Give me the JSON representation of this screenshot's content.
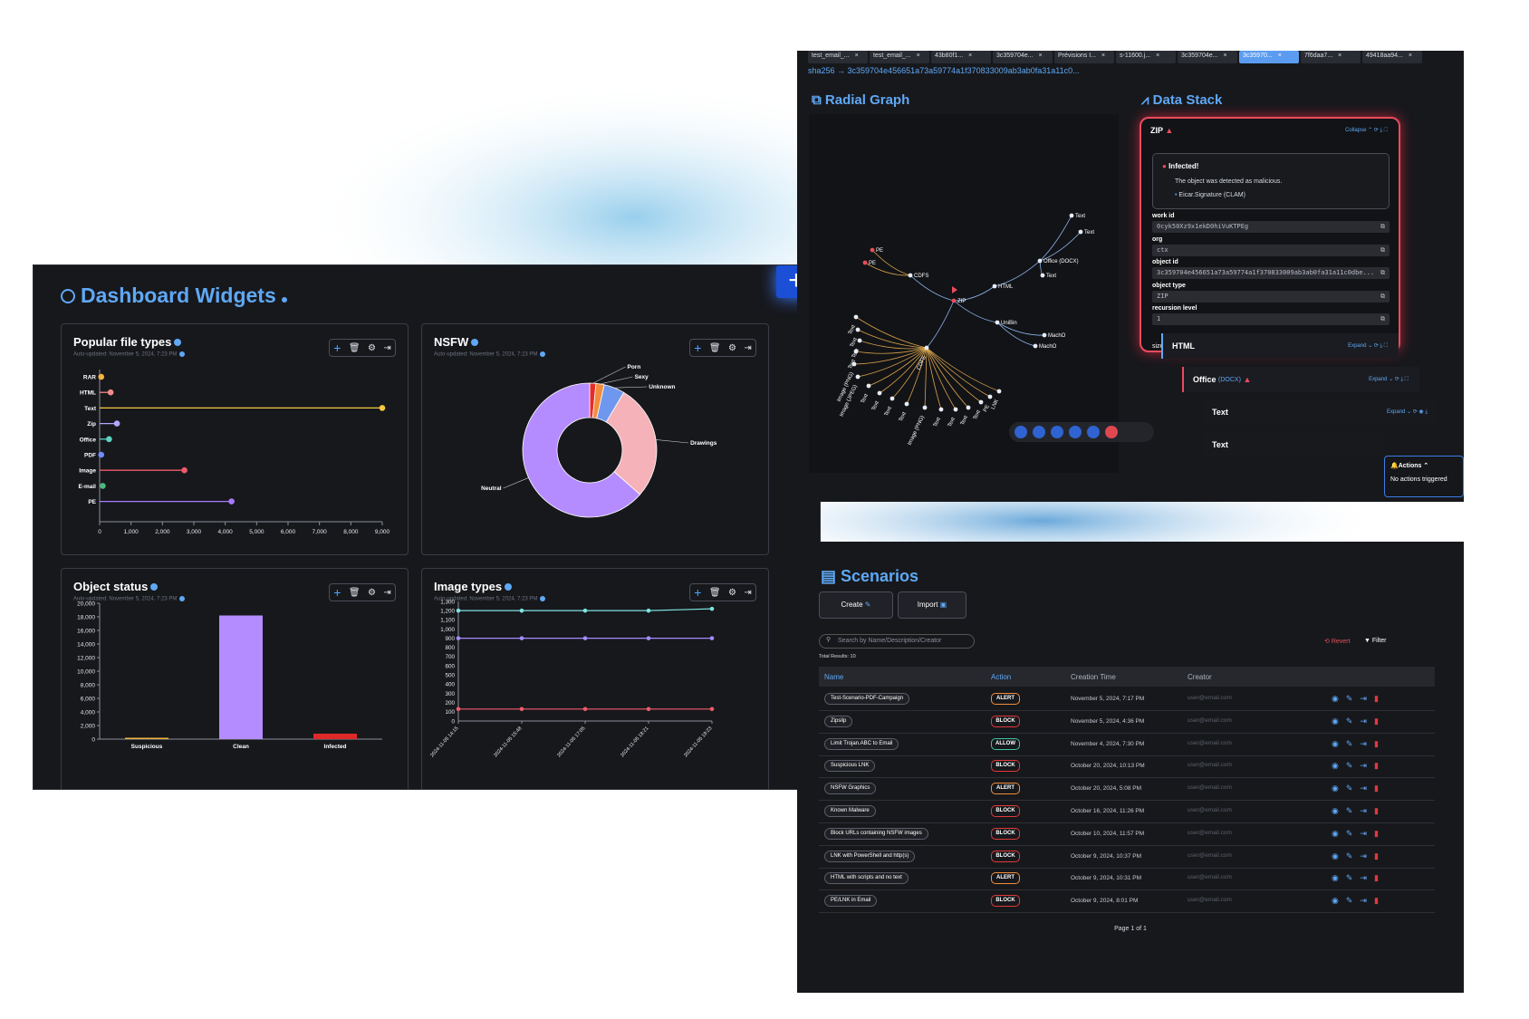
{
  "dashboard": {
    "title": "Dashboard Widgets",
    "add": "+",
    "cards": {
      "popular": {
        "title": "Popular file types",
        "sub": "Auto-updated: November 5, 2024, 7:23 PM"
      },
      "nsfw": {
        "title": "NSFW",
        "sub": "Auto-updated: November 5, 2024, 7:23 PM"
      },
      "status": {
        "title": "Object status",
        "sub": "Auto-updated: November 5, 2024, 7:23 PM"
      },
      "image": {
        "title": "Image types",
        "sub": "Auto-updated: November 5, 2024, 7:23 PM"
      }
    },
    "toolbar_icons": [
      "plus-icon",
      "trash-icon",
      "gear-icon",
      "export-icon"
    ]
  },
  "chart_data": [
    {
      "type": "scatter",
      "title": "Popular file types",
      "categories": [
        "RAR",
        "HTML",
        "Text",
        "Zip",
        "Office",
        "PDF",
        "Image",
        "E-mail",
        "PE"
      ],
      "values": [
        50,
        350,
        9000,
        550,
        300,
        50,
        2700,
        100,
        4200
      ],
      "colors": [
        "#f5b53d",
        "#f28b8b",
        "#f5c842",
        "#b6a6ff",
        "#5fd3c2",
        "#6f8cff",
        "#ef5b6c",
        "#4cb87a",
        "#a77bff"
      ],
      "xticks": [
        "0",
        "1,000",
        "2,000",
        "3,000",
        "4,000",
        "5,000",
        "6,000",
        "7,000",
        "8,000",
        "9,000"
      ],
      "xlim": [
        0,
        9000
      ]
    },
    {
      "type": "pie",
      "title": "NSFW",
      "labels": [
        "Porn",
        "Sexy",
        "Unknown",
        "Drawings",
        "Neutral"
      ],
      "values": [
        1.5,
        2,
        5,
        28,
        63.5
      ],
      "colors": [
        "#e82c2c",
        "#f28d3b",
        "#6f97ee",
        "#f5b2b8",
        "#b48cff"
      ]
    },
    {
      "type": "bar",
      "title": "Object status",
      "categories": [
        "Suspicious",
        "Clean",
        "Infected"
      ],
      "values": [
        150,
        18200,
        800
      ],
      "colors": [
        "#f5b53d",
        "#b48cff",
        "#e02828"
      ],
      "yticks": [
        "0",
        "2,000",
        "4,000",
        "6,000",
        "8,000",
        "10,000",
        "12,000",
        "14,000",
        "16,000",
        "18,000",
        "20,000"
      ],
      "ylim": [
        0,
        20000
      ]
    },
    {
      "type": "line",
      "title": "Image types",
      "x": [
        "2024-11-05 14:15",
        "2024-11-05 15:48",
        "2024-11-05 17:05",
        "2024-11-05 18:21",
        "2024-11-05 19:23"
      ],
      "series": [
        {
          "values": [
            1200,
            1200,
            1200,
            1200,
            1220
          ],
          "color": "#7de3e0"
        },
        {
          "values": [
            900,
            900,
            900,
            900,
            900
          ],
          "color": "#a68bff"
        },
        {
          "values": [
            130,
            130,
            130,
            130,
            130
          ],
          "color": "#ef5b6c"
        }
      ],
      "yticks": [
        "0",
        "100",
        "200",
        "300",
        "400",
        "500",
        "600",
        "700",
        "800",
        "900",
        "1,000",
        "1,100",
        "1,200",
        "1,300"
      ],
      "ylim": [
        0,
        1300
      ]
    }
  ],
  "radial": {
    "tabs": [
      "test_email_...",
      "test_email_...",
      "43b80f1...",
      "3c359704e...",
      "Prévisions I...",
      "s-11600.j...",
      "3c359704e...",
      "3c35970...",
      "7f6daa7...",
      "49418aa94..."
    ],
    "sha": "sha256 → 3c359704e456651a73a59774a1f370833009ab3ab0fa31a11c0...",
    "graph_title": "Radial Graph",
    "stack_title": "Data Stack",
    "nodes": [
      "PE",
      "PE",
      "CDFS",
      "ZIP",
      "HTML",
      "Office (DOCX)",
      "Text",
      "Text",
      "Text",
      "UniBin",
      "MachO",
      "MachO",
      "Text",
      "CDFS",
      "Text",
      "Text",
      "Text",
      "Image (PNG)",
      "Image (JPEG)",
      "Text",
      "Text",
      "Text",
      "Text",
      "Image (PNG)",
      "Text",
      "Text",
      "Text",
      "Text",
      "PE",
      "LNK"
    ]
  },
  "stack": {
    "zip": "ZIP",
    "collapse": "Collapse",
    "infected": "Infected!",
    "msg": "The object was detected as malicious.",
    "sig": "Eicar.Signature (CLAM)",
    "fields": [
      {
        "label": "work id",
        "value": "0cyk50Xz9x1ekD0hiVuKTPEg"
      },
      {
        "label": "org",
        "value": "ctx"
      },
      {
        "label": "object id",
        "value": "3c359704e456651a73a59774a1f370833009ab3ab0fa31a11c0dbe..."
      },
      {
        "label": "object type",
        "value": "ZIP"
      },
      {
        "label": "recursion level",
        "value": "1"
      }
    ],
    "size": "size",
    "html": "HTML",
    "office": "Office",
    "office_tag": "(DOCX)",
    "text1": "Text",
    "text2": "Text",
    "expand": "Expand",
    "actions": "Actions",
    "no_actions": "No actions triggered"
  },
  "scenarios": {
    "title": "Scenarios",
    "create": "Create",
    "import": "Import",
    "search_placeholder": "Search by Name/Description/Creator",
    "total": "Total Results: 10",
    "revert": "Revert",
    "filter": "Filter",
    "cols": [
      "Name",
      "Action",
      "Creation Time",
      "Creator"
    ],
    "rows": [
      {
        "name": "Test-Scenario-PDF-Campaign",
        "action": "ALERT",
        "time": "November 5, 2024, 7:17 PM",
        "creator": "user@email.com"
      },
      {
        "name": "Zipslip",
        "action": "BLOCK",
        "time": "November 5, 2024, 4:36 PM",
        "creator": "user@email.com"
      },
      {
        "name": "Limit Trojan.ABC to Email",
        "action": "ALLOW",
        "time": "November 4, 2024, 7:30 PM",
        "creator": "user@email.com"
      },
      {
        "name": "Suspicious LNK",
        "action": "BLOCK",
        "time": "October 20, 2024, 10:13 PM",
        "creator": "user@email.com"
      },
      {
        "name": "NSFW Graphics",
        "action": "ALERT",
        "time": "October 20, 2024, 5:08 PM",
        "creator": "user@email.com"
      },
      {
        "name": "Known Malware",
        "action": "BLOCK",
        "time": "October 16, 2024, 11:26 PM",
        "creator": "user@email.com"
      },
      {
        "name": "Block URLs containing NSFW images",
        "action": "BLOCK",
        "time": "October 10, 2024, 11:57 PM",
        "creator": "user@email.com"
      },
      {
        "name": "LNK with PowerShell and http(s)",
        "action": "BLOCK",
        "time": "October 9, 2024, 10:37 PM",
        "creator": "user@email.com"
      },
      {
        "name": "HTML with scripts and no text",
        "action": "ALERT",
        "time": "October 9, 2024, 10:31 PM",
        "creator": "user@email.com"
      },
      {
        "name": "PE/LNK in Email",
        "action": "BLOCK",
        "time": "October 9, 2024, 8:01 PM",
        "creator": "user@email.com"
      }
    ],
    "page": "Page 1 of 1"
  }
}
